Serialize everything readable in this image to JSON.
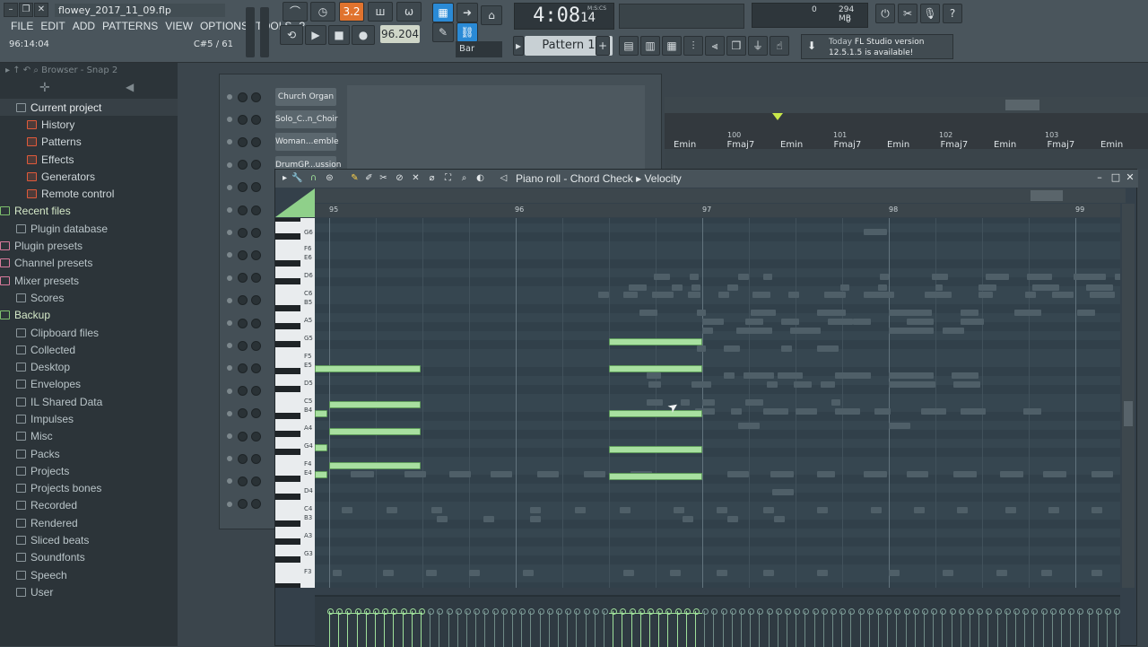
{
  "titlebar": {
    "file_name": "flowey_2017_11_09.flp"
  },
  "menu": [
    "FILE",
    "EDIT",
    "ADD",
    "PATTERNS",
    "VIEW",
    "OPTIONS",
    "TOOLS",
    "?"
  ],
  "hint": {
    "time": "96:14:04",
    "note": "C#5 / 61"
  },
  "transport": {
    "time_main": "4:08",
    "time_sub": "14",
    "time_unit": "M:S:CS",
    "tempo": "96.204",
    "pattern": "Pattern 1",
    "snap": "Bar",
    "value_32": "3.2"
  },
  "cpu": {
    "voices": "0",
    "memory": "294 MB",
    "polyphony": "0"
  },
  "news": {
    "today": "Today",
    "line1": "FL Studio version",
    "line2": "12.5.1.5 is available!"
  },
  "browser": {
    "header": "Browser - Snap 2",
    "items": [
      {
        "label": "Current project",
        "kind": "top"
      },
      {
        "label": "History",
        "kind": "sub"
      },
      {
        "label": "Patterns",
        "kind": "sub"
      },
      {
        "label": "Effects",
        "kind": "sub"
      },
      {
        "label": "Generators",
        "kind": "sub"
      },
      {
        "label": "Remote control",
        "kind": "sub"
      },
      {
        "label": "Recent files",
        "kind": "green"
      },
      {
        "label": "Plugin database",
        "kind": "folder"
      },
      {
        "label": "Plugin presets",
        "kind": "pink"
      },
      {
        "label": "Channel presets",
        "kind": "pink"
      },
      {
        "label": "Mixer presets",
        "kind": "pink"
      },
      {
        "label": "Scores",
        "kind": "folder"
      },
      {
        "label": "Backup",
        "kind": "green"
      },
      {
        "label": "Clipboard files",
        "kind": "folder"
      },
      {
        "label": "Collected",
        "kind": "folder"
      },
      {
        "label": "Desktop",
        "kind": "folder"
      },
      {
        "label": "Envelopes",
        "kind": "folder"
      },
      {
        "label": "IL Shared Data",
        "kind": "folder"
      },
      {
        "label": "Impulses",
        "kind": "folder"
      },
      {
        "label": "Misc",
        "kind": "folder"
      },
      {
        "label": "Packs",
        "kind": "folder"
      },
      {
        "label": "Projects",
        "kind": "folder"
      },
      {
        "label": "Projects bones",
        "kind": "folder"
      },
      {
        "label": "Recorded",
        "kind": "folder"
      },
      {
        "label": "Rendered",
        "kind": "folder"
      },
      {
        "label": "Sliced beats",
        "kind": "folder"
      },
      {
        "label": "Soundfonts",
        "kind": "folder"
      },
      {
        "label": "Speech",
        "kind": "folder"
      },
      {
        "label": "User",
        "kind": "folder"
      }
    ]
  },
  "channels": [
    "Church Organ",
    "Solo_C..n_Choir",
    "Woman...emble",
    "DrumGP...ussion"
  ],
  "playlist": {
    "bars": [
      "100",
      "101",
      "102",
      "103"
    ],
    "chords": [
      "Emin",
      "Fmaj7",
      "Emin",
      "Fmaj7",
      "Emin",
      "Fmaj7",
      "Emin",
      "Fmaj7",
      "Emin"
    ]
  },
  "piano_roll": {
    "title_parts": [
      "Piano roll",
      "Chord Check",
      "Velocity"
    ],
    "bars": [
      "95",
      "96",
      "97",
      "98",
      "99"
    ],
    "key_labels": [
      "G6",
      "F6",
      "E6",
      "D6",
      "C6",
      "B5",
      "A5",
      "G5",
      "F5",
      "E5",
      "D5",
      "C5",
      "B4",
      "A4",
      "G4",
      "F4",
      "E4",
      "D4",
      "C4",
      "B3",
      "A3",
      "G3",
      "F3"
    ]
  },
  "colors": {
    "note": "#a8e0a0",
    "accent_orange": "#e0732e",
    "accent_blue": "#2a8ad6",
    "ghost_note": "#4f5f68"
  },
  "icons": [
    "minimize-icon",
    "restore-icon",
    "close-icon",
    "play-icon",
    "stop-icon",
    "record-icon",
    "pencil-icon",
    "brush-icon",
    "magnet-icon",
    "zoom-icon",
    "speaker-icon",
    "download-icon"
  ]
}
